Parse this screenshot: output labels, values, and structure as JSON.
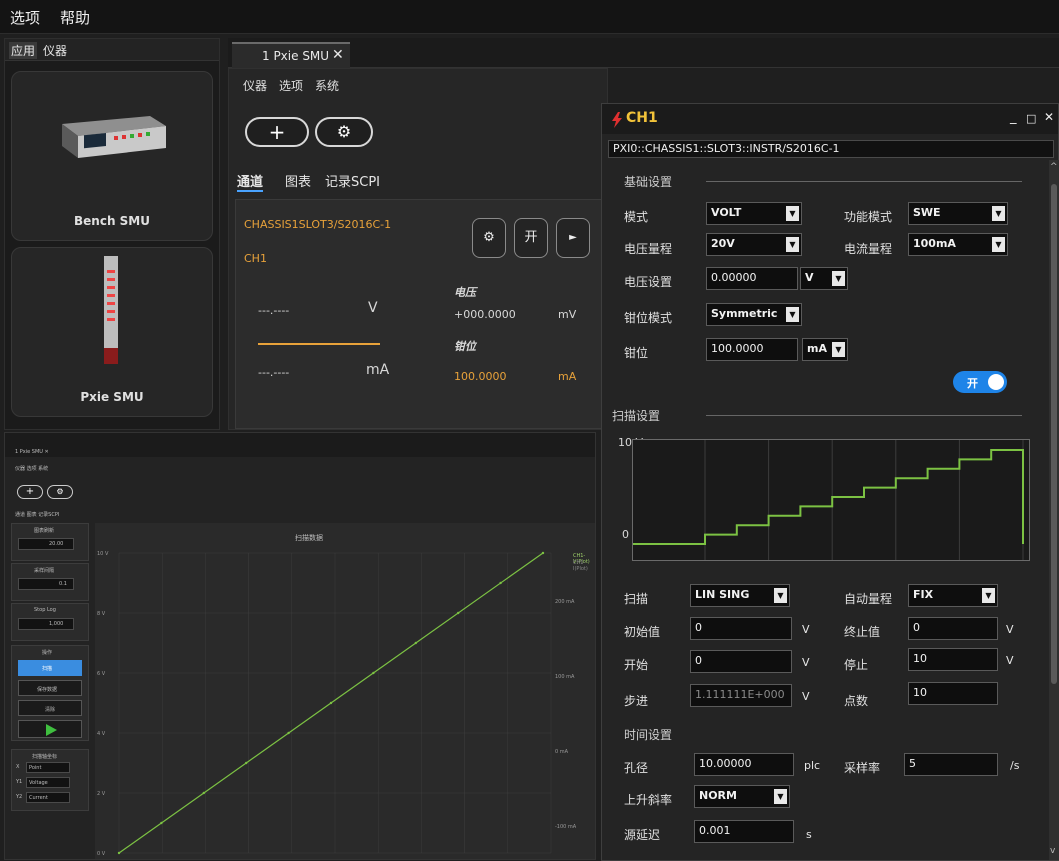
{
  "menubar": {
    "options": "选项",
    "help": "帮助"
  },
  "left_panel": {
    "tabs": [
      "应用",
      "仪器"
    ],
    "cards": [
      {
        "label": "Bench SMU"
      },
      {
        "label": "Pxie SMU"
      }
    ]
  },
  "main": {
    "tab_label": "1 Pxie SMU",
    "tab_close": "✕",
    "submenu": [
      "仪器",
      "选项",
      "系统"
    ],
    "add_glyph": "+",
    "settings_glyph": "⚙",
    "channel_tabs": [
      "通道",
      "图表",
      "记录SCPI"
    ],
    "channel": {
      "resource": "CHASSIS1SLOT3/S2016C-1",
      "name": "CH1",
      "btn_gear": "⚙",
      "btn_on": "开",
      "btn_play": "►",
      "voltage_reading": "---.----",
      "voltage_unit": "V",
      "current_reading": "---.----",
      "current_unit": "mA",
      "voltage_label": "电压",
      "voltage_value": "+000.0000",
      "voltage_value_unit": "mV",
      "clamp_label": "钳位",
      "clamp_value": "100.0000",
      "clamp_unit": "mA"
    }
  },
  "mini_window": {
    "tab": "1 Pxie SMU ✕",
    "menu": "仪器 选项 系统",
    "tabs": "通道 图表 记录SCPI",
    "chart_title": "扫描数据",
    "box1_title": "图表刷新",
    "box1_value": "20.00",
    "box2_title": "采样间隔",
    "box2_value": "0.1",
    "box3_title": "Stop Log",
    "box3_value": "1,000",
    "ops_title": "操作",
    "op_buttons": [
      "扫描",
      "保存数据",
      "清除"
    ],
    "axes_title": "扫描轴坐标",
    "axes_rows": [
      {
        "key": "X",
        "value": "Point"
      },
      {
        "key": "Y1",
        "value": "Voltage"
      },
      {
        "key": "Y2",
        "value": "Current"
      }
    ],
    "y_ticks": [
      "10 V",
      "8 V",
      "6 V",
      "4 V",
      "2 V",
      "0 V"
    ],
    "y2_ticks": [
      "200 mA",
      "100 mA",
      "0 mA",
      "-100 mA"
    ],
    "legend": [
      "CH1-V(Plot)",
      "CH1-I(Plot)"
    ],
    "line_color": "#7cc243"
  },
  "dialog": {
    "title": "CH1",
    "controls": [
      "_",
      "□",
      "✕"
    ],
    "resource": "PXI0::CHASSIS1::SLOT3::INSTR/S2016C-1",
    "basic_section": "基础设置",
    "mode_label": "模式",
    "mode_value": "VOLT",
    "func_mode_label": "功能模式",
    "func_mode_value": "SWE",
    "vrange_label": "电压量程",
    "vrange_value": "20V",
    "irange_label": "电流量程",
    "irange_value": "100mA",
    "vset_label": "电压设置",
    "vset_value": "0.00000",
    "vset_unit": "V",
    "clamp_mode_label": "钳位模式",
    "clamp_mode_value": "Symmetric",
    "clamp_label": "钳位",
    "clamp_value": "100.0000",
    "clamp_unit": "mA",
    "output_toggle": "开",
    "sweep_section": "扫描设置",
    "sweep_chart": {
      "y_top": "10 V",
      "y_bottom": "0",
      "steps": 10,
      "y_max": 10,
      "line_color": "#7cc243"
    },
    "sweep_label": "扫描",
    "sweep_value": "LIN SING",
    "autorange_label": "自动量程",
    "autorange_value": "FIX",
    "initial_label": "初始值",
    "initial_value": "0",
    "initial_unit": "V",
    "end_label": "终止值",
    "end_value": "0",
    "end_unit": "V",
    "start_label": "开始",
    "start_value": "0",
    "start_unit": "V",
    "stop_label": "停止",
    "stop_value": "10",
    "stop_unit": "V",
    "step_label": "步进",
    "step_value": "1.111111E+000",
    "step_unit": "V",
    "points_label": "点数",
    "points_value": "10",
    "time_section": "时间设置",
    "aperture_label": "孔径",
    "aperture_value": "10.00000",
    "aperture_unit": "plc",
    "rate_label": "采样率",
    "rate_value": "5",
    "rate_unit": "/s",
    "slew_label": "上升斜率",
    "slew_value": "NORM",
    "delay_label": "源延迟",
    "delay_value": "0.001",
    "delay_unit": "s",
    "scroll_up": "^",
    "scroll_down": "v",
    "title_icon_color": "#e03030"
  }
}
